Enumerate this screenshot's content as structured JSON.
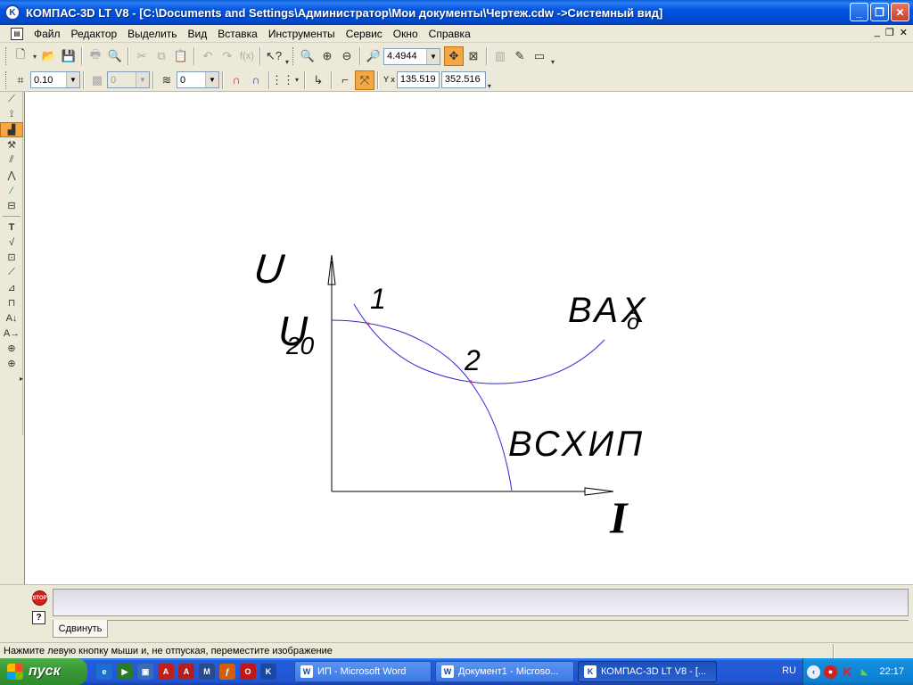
{
  "window": {
    "title": "КОМПАС-3D LT V8 - [C:\\Documents and Settings\\Администратор\\Мои документы\\Чертеж.cdw ->Системный вид]",
    "minimize": "_",
    "maximize": "❐",
    "close": "✕"
  },
  "menu": {
    "items": [
      "Файл",
      "Редактор",
      "Выделить",
      "Вид",
      "Вставка",
      "Инструменты",
      "Сервис",
      "Окно",
      "Справка"
    ],
    "mdi_minimize": "_",
    "mdi_restore": "❐",
    "mdi_close": "✕"
  },
  "toolbar1": {
    "zoom_value": "4.4944"
  },
  "toolbar2": {
    "step_value": "0.10",
    "style_value": "0",
    "layer_value": "0",
    "coord_label": "Y x",
    "x_value": "135.519",
    "y_value": "352.516"
  },
  "drawing": {
    "axis_y_label": "U",
    "u20_label": "U",
    "u20_subscript": "20",
    "point1_label": "1",
    "point2_label": "2",
    "vax_label": "ВАХ",
    "vax_subscript": "д",
    "vship_label": "ВСХИП",
    "axis_x_label": "I",
    "curve_color": "#2a2ad0",
    "axis_color": "#000000",
    "point_color": "#e03060"
  },
  "bottom": {
    "stop_label": "STOP",
    "help_label": "?",
    "tab_label": "Сдвинуть"
  },
  "status": {
    "text": "Нажмите левую кнопку мыши и, не отпуская, переместите изображение"
  },
  "taskbar": {
    "start_label": "пуск",
    "buttons": [
      "ИП - Microsoft Word",
      "Документ1 - Microso...",
      "КОМПАС-3D LT V8 - [..."
    ],
    "language": "RU",
    "clock": "22:17"
  }
}
